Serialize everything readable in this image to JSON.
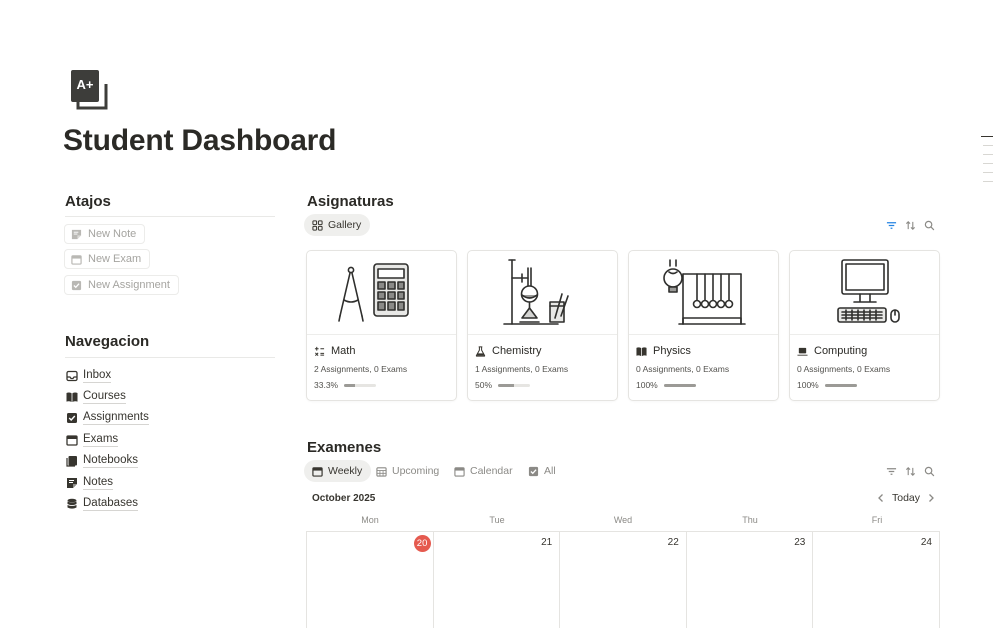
{
  "page": {
    "title": "Student Dashboard",
    "icon": "a-plus-grade-icon"
  },
  "shortcuts": {
    "heading": "Atajos",
    "items": [
      {
        "label": "New Note",
        "icon": "note-icon"
      },
      {
        "label": "New Exam",
        "icon": "calendar-icon"
      },
      {
        "label": "New Assignment",
        "icon": "checkbox-icon"
      }
    ]
  },
  "navigation": {
    "heading": "Navegacion",
    "items": [
      {
        "label": "Inbox",
        "icon": "inbox-icon"
      },
      {
        "label": "Courses",
        "icon": "book-open-icon"
      },
      {
        "label": "Assignments",
        "icon": "checkbox-icon"
      },
      {
        "label": "Exams",
        "icon": "calendar-icon"
      },
      {
        "label": "Notebooks",
        "icon": "notebooks-icon"
      },
      {
        "label": "Notes",
        "icon": "note-icon"
      },
      {
        "label": "Databases",
        "icon": "database-icon"
      }
    ]
  },
  "subjects": {
    "heading": "Asignaturas",
    "view_tab": "Gallery",
    "cards": [
      {
        "name": "Math",
        "summary": "2 Assignments, 0 Exams",
        "progress_label": "33.3%",
        "progress": 0.333,
        "icon": "math-operators-icon",
        "image": "compass-calculator-illustration"
      },
      {
        "name": "Chemistry",
        "summary": "1 Assignments, 0 Exams",
        "progress_label": "50%",
        "progress": 0.5,
        "icon": "flask-icon",
        "image": "lab-flask-illustration"
      },
      {
        "name": "Physics",
        "summary": "0 Assignments, 0 Exams",
        "progress_label": "100%",
        "progress": 1.0,
        "icon": "book-open-icon",
        "image": "newtons-cradle-illustration"
      },
      {
        "name": "Computing",
        "summary": "0 Assignments, 0 Exams",
        "progress_label": "100%",
        "progress": 1.0,
        "icon": "laptop-icon",
        "image": "desktop-computer-illustration"
      }
    ]
  },
  "exams": {
    "heading": "Examenes",
    "tabs": [
      {
        "label": "Weekly",
        "icon": "calendar-icon",
        "active": true
      },
      {
        "label": "Upcoming",
        "icon": "calendar-grid-icon",
        "active": false
      },
      {
        "label": "Calendar",
        "icon": "calendar-icon",
        "active": false
      },
      {
        "label": "All",
        "icon": "checkbox-icon",
        "active": false
      }
    ],
    "month": "October 2025",
    "today_label": "Today",
    "weekdays": [
      "Mon",
      "Tue",
      "Wed",
      "Thu",
      "Fri"
    ],
    "days": [
      "20",
      "21",
      "22",
      "23",
      "24"
    ],
    "today_index": 0
  },
  "colors": {
    "accent_filter": "#2383e2",
    "today_badge": "#e55a4f",
    "text": "#37352f"
  }
}
